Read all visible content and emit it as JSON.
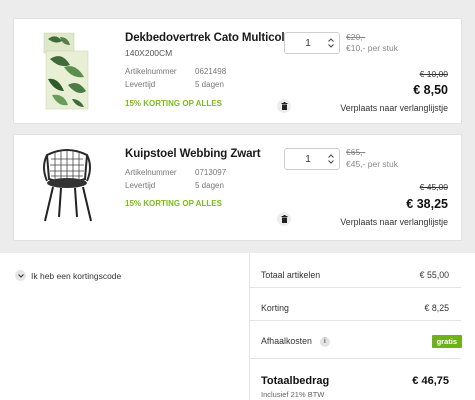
{
  "cart": {
    "items": [
      {
        "name": "Dekbedovertrek Cato Multicolor",
        "size": "140X200CM",
        "article_label": "Artikelnummer",
        "article_number": "0621498",
        "delivery_label": "Levertijd",
        "delivery_time": "5 dagen",
        "promo": "15% KORTING OP ALLES",
        "quantity": "1",
        "unit_price_old": "€20,-",
        "unit_price_new": "€10,- per stuk",
        "price_old": "€ 10,00",
        "price": "€ 8,50",
        "wishlist_label": "Verplaats naar verlanglijstje"
      },
      {
        "name": "Kuipstoel Webbing Zwart",
        "article_label": "Artikelnummer",
        "article_number": "0713097",
        "delivery_label": "Levertijd",
        "delivery_time": "5 dagen",
        "promo": "15% KORTING OP ALLES",
        "quantity": "1",
        "unit_price_old": "€65,-",
        "unit_price_new": "€45,- per stuk",
        "price_old": "€ 45,00",
        "price": "€ 38,25",
        "wishlist_label": "Verplaats naar verlanglijstje"
      }
    ]
  },
  "coupon": {
    "label": "Ik heb een kortingscode"
  },
  "summary": {
    "total_articles_label": "Totaal artikelen",
    "total_articles_value": "€ 55,00",
    "discount_label": "Korting",
    "discount_value": "€ 8,25",
    "pickup_label": "Afhaalkosten",
    "pickup_info": "i",
    "pickup_value": "gratis",
    "total_label": "Totaalbedrag",
    "total_value": "€ 46,75",
    "vat_note": "Inclusief 21% BTW"
  },
  "colors": {
    "promo_green": "#7dbb1a",
    "gratis_badge": "#6fb11a"
  },
  "icons": [
    "trash-icon",
    "chevron-up-icon",
    "chevron-down-icon",
    "info-icon"
  ]
}
